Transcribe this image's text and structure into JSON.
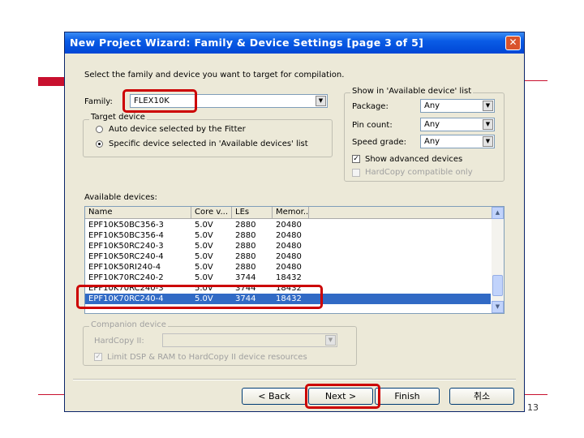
{
  "window": {
    "title": "New Project Wizard: Family & Device Settings [page 3 of 5]",
    "close_glyph": "✕"
  },
  "intro": "Select the family and device you want to target for compilation.",
  "family": {
    "label": "Family:",
    "value": "FLEX10K"
  },
  "target_device": {
    "legend": "Target device",
    "options": [
      {
        "label": "Auto device selected by the Fitter",
        "selected": false
      },
      {
        "label": "Specific device selected in 'Available devices' list",
        "selected": true
      }
    ]
  },
  "filters": {
    "legend": "Show in 'Available device' list",
    "package": {
      "label": "Package:",
      "value": "Any"
    },
    "pin_count": {
      "label": "Pin count:",
      "value": "Any"
    },
    "speed_grade": {
      "label": "Speed grade:",
      "value": "Any"
    },
    "show_advanced": {
      "label": "Show advanced devices",
      "checked": true
    },
    "hardcopy_compatible": {
      "label": "HardCopy compatible only",
      "checked": false
    }
  },
  "available": {
    "label": "Available devices:",
    "columns": [
      "Name",
      "Core v...",
      "LEs",
      "Memor..."
    ],
    "rows": [
      [
        "EPF10K50BC356-3",
        "5.0V",
        "2880",
        "20480"
      ],
      [
        "EPF10K50BC356-4",
        "5.0V",
        "2880",
        "20480"
      ],
      [
        "EPF10K50RC240-3",
        "5.0V",
        "2880",
        "20480"
      ],
      [
        "EPF10K50RC240-4",
        "5.0V",
        "2880",
        "20480"
      ],
      [
        "EPF10K50RI240-4",
        "5.0V",
        "2880",
        "20480"
      ],
      [
        "EPF10K70RC240-2",
        "5.0V",
        "3744",
        "18432"
      ],
      [
        "EPF10K70RC240-3",
        "5.0V",
        "3744",
        "18432"
      ],
      [
        "EPF10K70RC240-4",
        "5.0V",
        "3744",
        "18432"
      ]
    ],
    "selected_index": 7
  },
  "companion": {
    "legend": "Companion device",
    "hardcopy_label": "HardCopy II:",
    "limit_label": "Limit DSP & RAM to HardCopy II device resources"
  },
  "buttons": {
    "back": "< Back",
    "next": "Next >",
    "finish": "Finish",
    "cancel": "취소"
  },
  "page_number": "13",
  "icons": {
    "dropdown": "▼",
    "scroll_up": "▲",
    "scroll_down": "▼",
    "check": "✓"
  },
  "colors": {
    "title_bar": "#0a5ce6",
    "selection": "#316ac5",
    "highlight": "#cc0000",
    "slide_accent": "#c8102e"
  }
}
